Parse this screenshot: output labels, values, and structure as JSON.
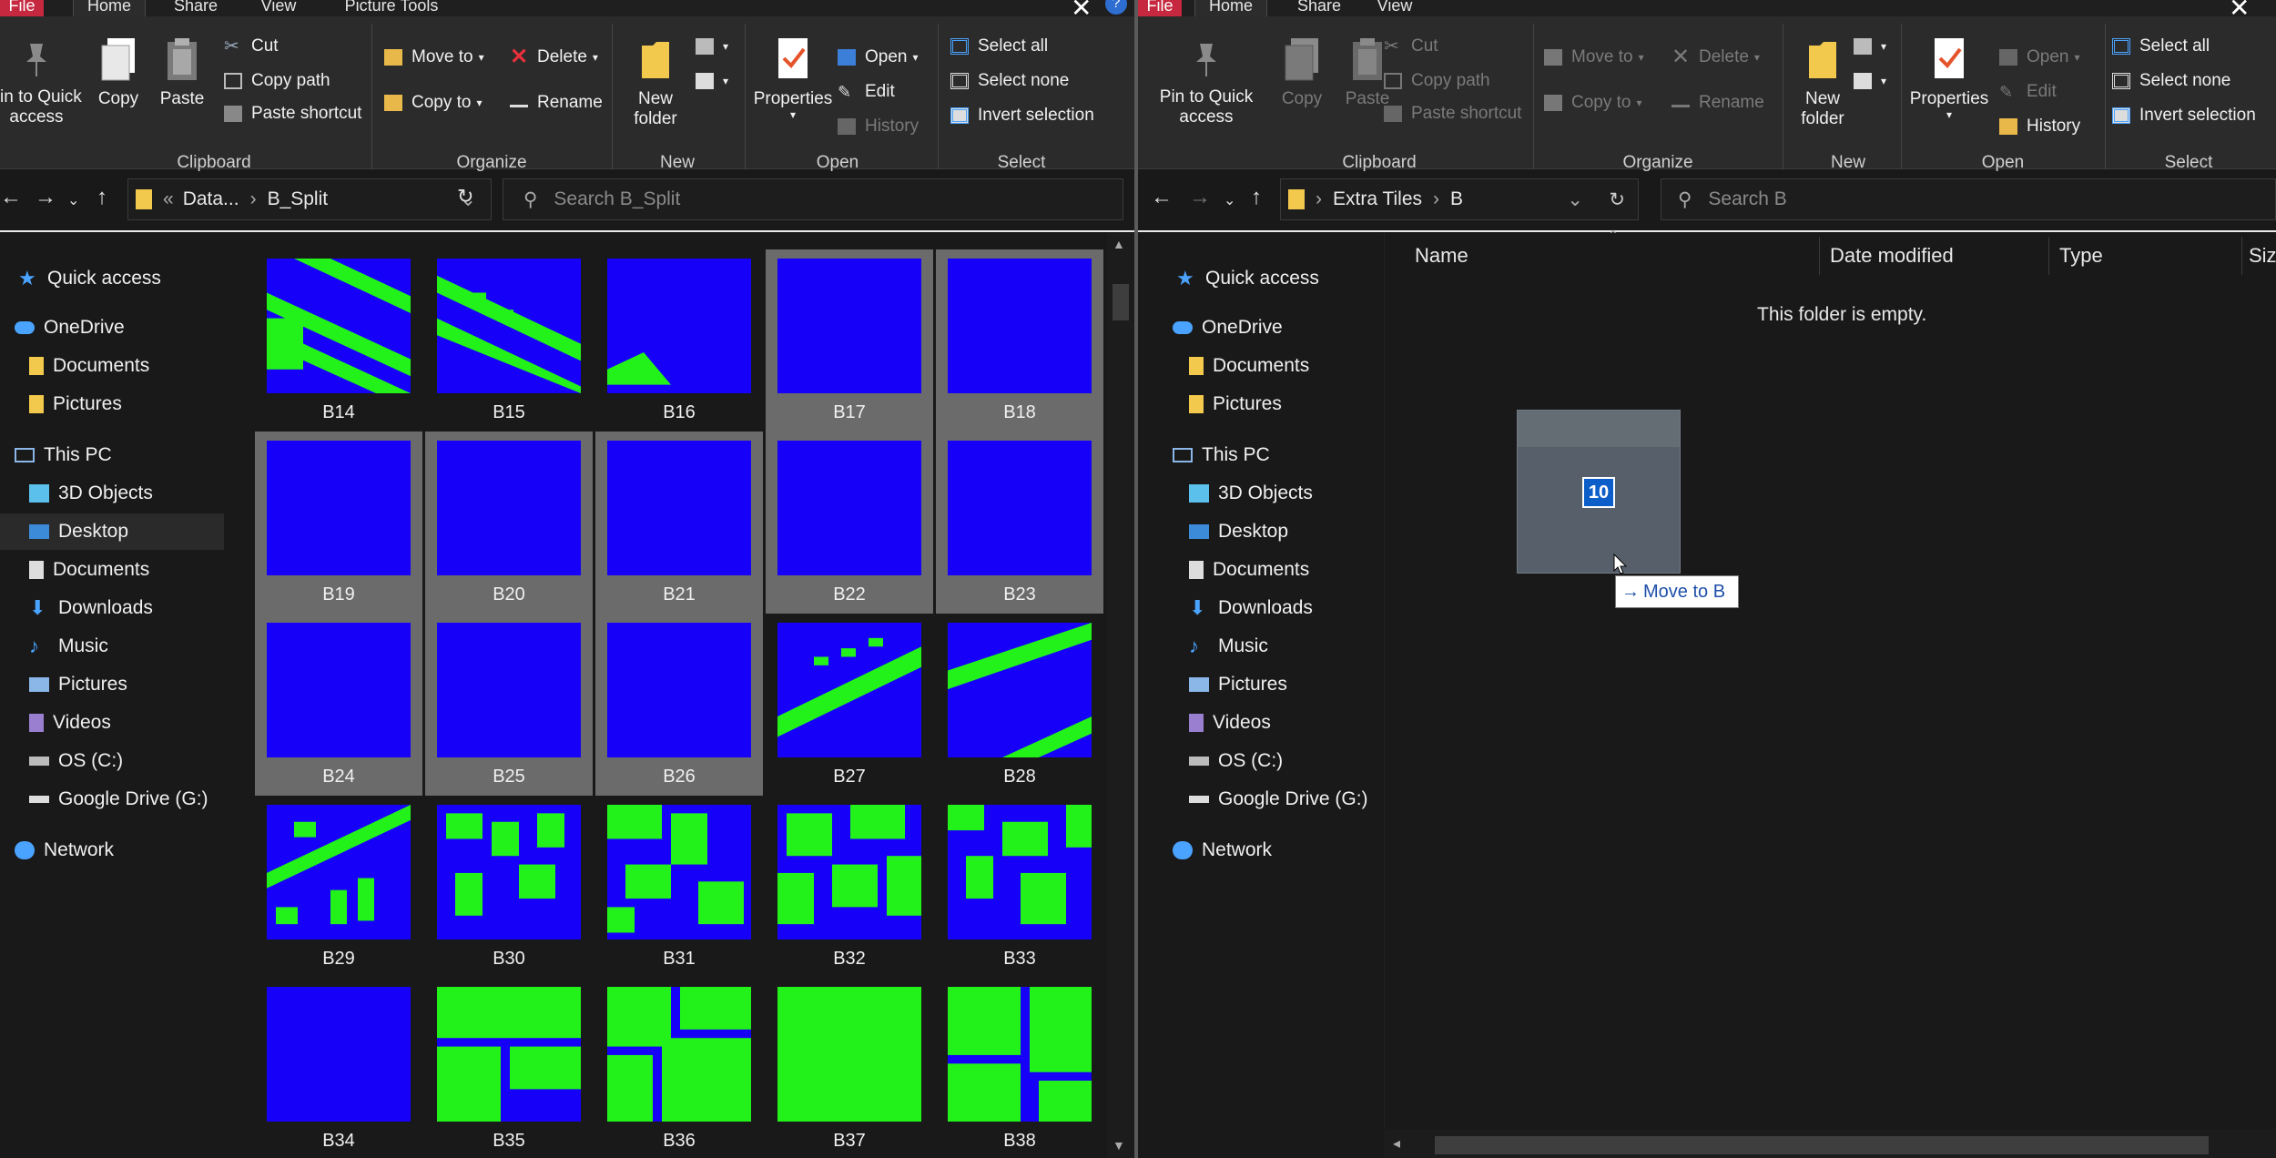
{
  "left": {
    "tabs": {
      "file": "File",
      "home": "Home",
      "share": "Share",
      "view": "View",
      "picture_tools": "Picture Tools"
    },
    "ribbon": {
      "pin": "in to Quick\naccess",
      "copy": "Copy",
      "paste": "Paste",
      "cut": "Cut",
      "copy_path": "Copy path",
      "paste_shortcut": "Paste shortcut",
      "move_to": "Move to",
      "copy_to": "Copy to",
      "delete": "Delete",
      "rename": "Rename",
      "new_folder": "New\nfolder",
      "properties": "Properties",
      "open": "Open",
      "edit": "Edit",
      "history": "History",
      "select_all": "Select all",
      "select_none": "Select none",
      "invert_selection": "Invert selection",
      "groups": {
        "clipboard": "Clipboard",
        "organize": "Organize",
        "new": "New",
        "open": "Open",
        "select": "Select"
      }
    },
    "address": {
      "crumbs": [
        "Data...",
        "B_Split"
      ],
      "search_placeholder": "Search B_Split"
    },
    "nav": {
      "quick_access": "Quick access",
      "onedrive": "OneDrive",
      "od_documents": "Documents",
      "od_pictures": "Pictures",
      "this_pc": "This PC",
      "objects3d": "3D Objects",
      "desktop": "Desktop",
      "documents": "Documents",
      "downloads": "Downloads",
      "music": "Music",
      "pictures": "Pictures",
      "videos": "Videos",
      "os": "OS (C:)",
      "gdrive": "Google Drive (G:)",
      "network": "Network"
    },
    "files": [
      {
        "name": "B14",
        "selected": false,
        "thumb": "stripes-a"
      },
      {
        "name": "B15",
        "selected": false,
        "thumb": "stripes-b"
      },
      {
        "name": "B16",
        "selected": false,
        "thumb": "corner"
      },
      {
        "name": "B17",
        "selected": true,
        "thumb": "blank"
      },
      {
        "name": "B18",
        "selected": true,
        "thumb": "blank"
      },
      {
        "name": "B19",
        "selected": true,
        "thumb": "blank"
      },
      {
        "name": "B20",
        "selected": true,
        "thumb": "blank"
      },
      {
        "name": "B21",
        "selected": true,
        "thumb": "blank"
      },
      {
        "name": "B22",
        "selected": true,
        "thumb": "blank"
      },
      {
        "name": "B23",
        "selected": true,
        "thumb": "blank"
      },
      {
        "name": "B24",
        "selected": true,
        "thumb": "blank"
      },
      {
        "name": "B25",
        "selected": true,
        "thumb": "blank"
      },
      {
        "name": "B26",
        "selected": true,
        "thumb": "blank"
      },
      {
        "name": "B27",
        "selected": false,
        "thumb": "diag"
      },
      {
        "name": "B28",
        "selected": false,
        "thumb": "diag2"
      },
      {
        "name": "B29",
        "selected": false,
        "thumb": "blocks-a"
      },
      {
        "name": "B30",
        "selected": false,
        "thumb": "blocks-b"
      },
      {
        "name": "B31",
        "selected": false,
        "thumb": "blocks-c"
      },
      {
        "name": "B32",
        "selected": false,
        "thumb": "blocks-d"
      },
      {
        "name": "B33",
        "selected": false,
        "thumb": "blocks-e"
      },
      {
        "name": "B34",
        "selected": false,
        "thumb": "blank"
      },
      {
        "name": "B35",
        "selected": false,
        "thumb": "dense-a"
      },
      {
        "name": "B36",
        "selected": false,
        "thumb": "dense-b"
      },
      {
        "name": "B37",
        "selected": false,
        "thumb": "dense-c"
      },
      {
        "name": "B38",
        "selected": false,
        "thumb": "dense-d"
      }
    ]
  },
  "right": {
    "tabs": {
      "file": "File",
      "home": "Home",
      "share": "Share",
      "view": "View"
    },
    "ribbon": {
      "pin": "Pin to Quick\naccess",
      "copy": "Copy",
      "paste": "Paste",
      "cut": "Cut",
      "copy_path": "Copy path",
      "paste_shortcut": "Paste shortcut",
      "move_to": "Move to",
      "copy_to": "Copy to",
      "delete": "Delete",
      "rename": "Rename",
      "new_folder": "New\nfolder",
      "properties": "Properties",
      "open": "Open",
      "edit": "Edit",
      "history": "History",
      "select_all": "Select all",
      "select_none": "Select none",
      "invert_selection": "Invert selection",
      "groups": {
        "clipboard": "Clipboard",
        "organize": "Organize",
        "new": "New",
        "open": "Open",
        "select": "Select"
      }
    },
    "address": {
      "crumbs": [
        "Extra Tiles",
        "B"
      ],
      "search_placeholder": "Search B"
    },
    "nav": {
      "quick_access": "Quick access",
      "onedrive": "OneDrive",
      "od_documents": "Documents",
      "od_pictures": "Pictures",
      "this_pc": "This PC",
      "objects3d": "3D Objects",
      "desktop": "Desktop",
      "documents": "Documents",
      "downloads": "Downloads",
      "music": "Music",
      "pictures": "Pictures",
      "videos": "Videos",
      "os": "OS (C:)",
      "gdrive": "Google Drive (G:)",
      "network": "Network"
    },
    "columns": {
      "name": "Name",
      "date_modified": "Date modified",
      "type": "Type",
      "size": "Size"
    },
    "empty_message": "This folder is empty.",
    "drag": {
      "count": "10",
      "tooltip": "Move to B"
    }
  },
  "colors": {
    "tile_blue": "#1600f8",
    "tile_green": "#22f21a",
    "selected_tile": "#6b6b6b",
    "file_tab": "#c5283f"
  }
}
